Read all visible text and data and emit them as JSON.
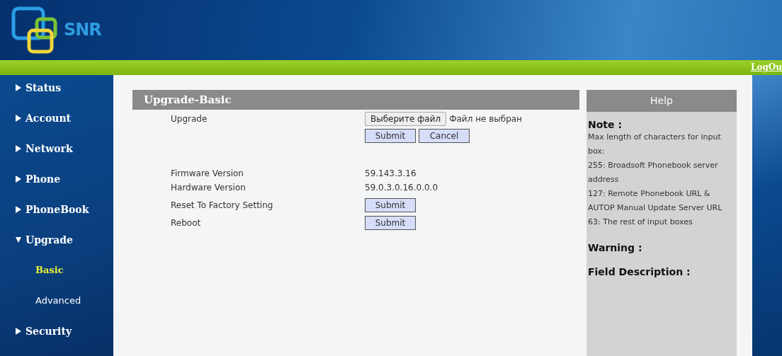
{
  "logo": {
    "text": "SNR"
  },
  "topbar": {
    "logout": "LogOu"
  },
  "sidebar": {
    "items": [
      {
        "label": "Status",
        "expanded": false,
        "selected": false
      },
      {
        "label": "Account",
        "expanded": false,
        "selected": false
      },
      {
        "label": "Network",
        "expanded": false,
        "selected": false
      },
      {
        "label": "Phone",
        "expanded": false,
        "selected": false
      },
      {
        "label": "PhoneBook",
        "expanded": false,
        "selected": false
      },
      {
        "label": "Upgrade",
        "expanded": true,
        "selected": false,
        "children": [
          {
            "label": "Basic",
            "selected": true
          },
          {
            "label": "Advanced",
            "selected": false
          }
        ]
      },
      {
        "label": "Security",
        "expanded": false,
        "selected": false
      }
    ]
  },
  "section": {
    "title": "Upgrade-Basic",
    "rows": [
      {
        "kind": "file",
        "label": "Upgrade",
        "choose": "Выберите файл",
        "status": "Файл не выбран",
        "buttons": [
          "Submit",
          "Cancel"
        ]
      },
      {
        "kind": "text",
        "label": "Firmware Version",
        "value": "59.143.3.16"
      },
      {
        "kind": "text",
        "label": "Hardware Version",
        "value": "59.0.3.0.16.0.0.0"
      },
      {
        "kind": "button",
        "label": "Reset To Factory Setting",
        "button": "Submit"
      },
      {
        "kind": "button",
        "label": "Reboot",
        "button": "Submit"
      }
    ]
  },
  "help": {
    "title": "Help",
    "note_heading": "Note :",
    "note_lines": [
      "Max length of characters for input box:",
      "255: Broadsoft Phonebook server address",
      "127: Remote Phonebook URL & AUTOP Manual Update Server URL",
      "63: The rest of input boxes"
    ],
    "warning_heading": "Warning :",
    "field_heading": "Field Description :"
  }
}
